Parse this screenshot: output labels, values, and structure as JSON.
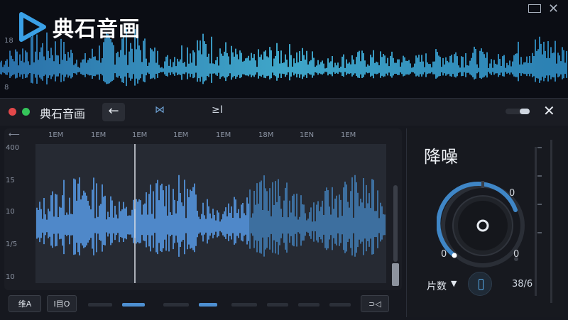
{
  "app": {
    "brand": "典石音画",
    "window_title": "典石音画"
  },
  "background": {
    "tick_labels": [
      "18",
      "8"
    ]
  },
  "toolbar": {
    "back_glyph": "←",
    "icon_a": "skip-icon",
    "icon_b": "play-end-icon",
    "icon_a_glyph": "⋈",
    "icon_b_glyph": "≥I"
  },
  "timeline": {
    "marks": [
      "1EM",
      "1EM",
      "1EM",
      "1EM",
      "1EM",
      "18M",
      "1EN",
      "1EM"
    ]
  },
  "y_axis": {
    "labels": [
      "400",
      "15",
      "10",
      "1/5",
      "10"
    ]
  },
  "bottom_bar": {
    "btn_left": "维A",
    "btn_mid": "I目O",
    "btn_right": "⊃◁"
  },
  "noise_panel": {
    "title": "降噪",
    "knob_top_right": "0",
    "knob_bottom_left": "0",
    "knob_bottom_right": "0",
    "select_label": "片数",
    "count": "38/6"
  },
  "colors": {
    "accent": "#4d8fd1",
    "wave": "#3fa6c9",
    "close": "#e3484a",
    "ok": "#35c55a"
  }
}
